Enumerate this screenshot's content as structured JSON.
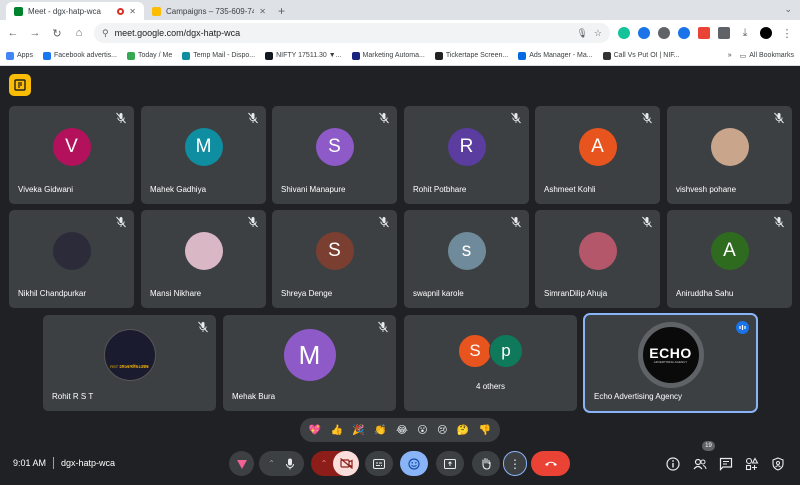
{
  "browser": {
    "tabs": [
      {
        "title": "Meet - dgx-hatp-wca",
        "favicon": "meet-icon",
        "active": true
      },
      {
        "title": "Campaigns – 735-609-7429",
        "favicon": "google-ads-icon",
        "active": false
      }
    ],
    "new_tab_label": "+",
    "url": "meet.google.com/dgx-hatp-wca",
    "bookmarks": [
      "Apps",
      "Facebook advertis...",
      "Today / Me",
      "Temp Mail - Dispo...",
      "NIFTY 17511.30 ▼...",
      "Marketing Automa...",
      "Tickertape Screen...",
      "Ads Manager - Ma...",
      "Call Vs Put OI | NIF..."
    ],
    "bookmarks_more": "»",
    "all_bookmarks": "All Bookmarks"
  },
  "participants": [
    {
      "name": "Viveka Gidwani",
      "initial": "V",
      "color": "#b3115b"
    },
    {
      "name": "Mahek Gadhiya",
      "initial": "M",
      "color": "#0e8ea0"
    },
    {
      "name": "Shivani Manapure",
      "initial": "S",
      "color": "#8e5ac8"
    },
    {
      "name": "Rohit Potbhare",
      "initial": "R",
      "color": "#5a3d9e"
    },
    {
      "name": "Ashmeet Kohli",
      "initial": "A",
      "color": "#e8541e"
    },
    {
      "name": "vishvesh pohane",
      "initial": "",
      "color": "#c9a58b"
    },
    {
      "name": "Nikhil Chandpurkar",
      "initial": "",
      "color": "#2b2b3a"
    },
    {
      "name": "Mansi Nikhare",
      "initial": "",
      "color": "#d9b7c5"
    },
    {
      "name": "Shreya Denge",
      "initial": "S",
      "color": "#7a3f31"
    },
    {
      "name": "swapnil karole",
      "initial": "s",
      "color": "#6f8a9a"
    },
    {
      "name": "SimranDilip Ahuja",
      "initial": "",
      "color": "#b5576a"
    },
    {
      "name": "Aniruddha Sahu",
      "initial": "A",
      "color": "#2e6b1f"
    },
    {
      "name": "Rohit R S T",
      "initial": "",
      "color": "#1b1b2f"
    },
    {
      "name": "Mehak Bura",
      "initial": "M",
      "color": "#8e5ac8"
    },
    {
      "name": "Echo Advertising Agency",
      "initial": "",
      "color": "#0a0a0a"
    }
  ],
  "others": {
    "label": "4 others",
    "initials": [
      "S",
      "p"
    ],
    "colors": [
      "#e8541e",
      "#0e7a5b"
    ]
  },
  "rohit_badge": "RST 𝕴𝕹𝕿𝕰𝕽𝕬𝕮𝕿𝕴𝖁𝕰",
  "echo_logo": {
    "main": "ECHO",
    "sub": "ADVERTISING AGENCY"
  },
  "reactions": [
    "💖",
    "👍",
    "🎉",
    "👏",
    "😂",
    "😮",
    "😢",
    "🤔",
    "👎"
  ],
  "meeting": {
    "time": "9:01 AM",
    "code": "dgx-hatp-wca",
    "participant_count": "19"
  },
  "colors": {
    "background": "#202124",
    "tile": "#3c4043",
    "accent": "#8ab4f8",
    "danger": "#ea4335"
  }
}
